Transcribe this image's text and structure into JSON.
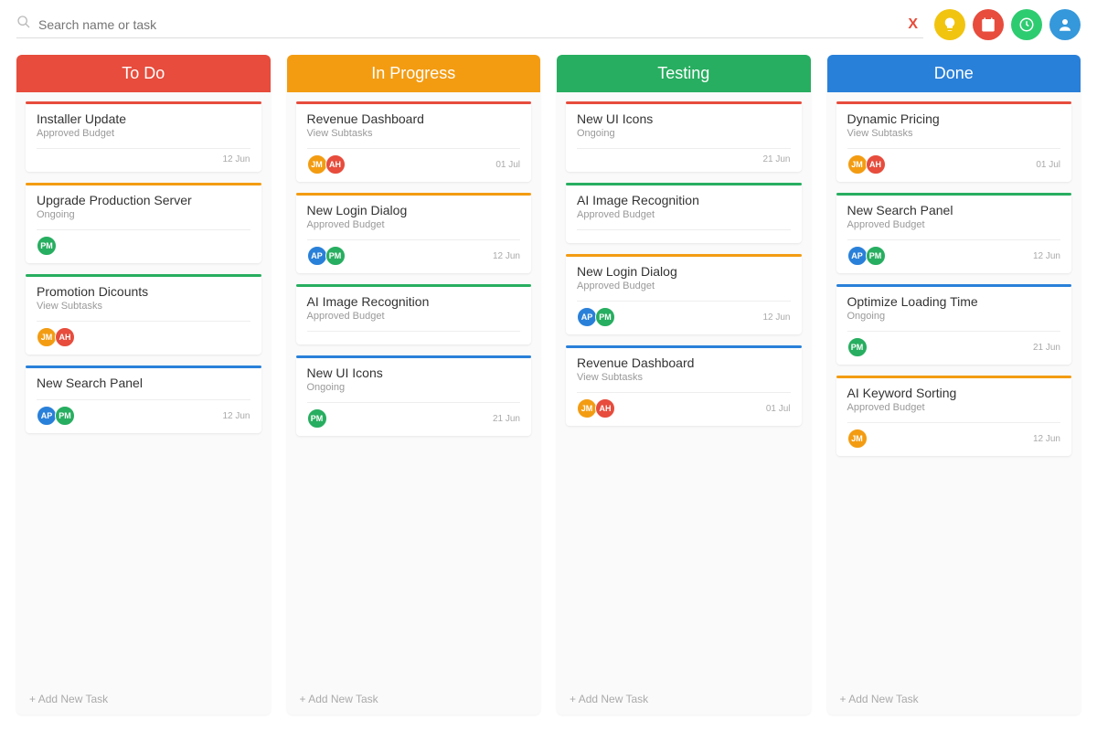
{
  "search": {
    "placeholder": "Search name or task",
    "clear_symbol": "X"
  },
  "top_icons": [
    {
      "name": "lightbulb-icon",
      "color": "#f1c40f"
    },
    {
      "name": "calendar-icon",
      "color": "#e74c3c"
    },
    {
      "name": "clock-icon",
      "color": "#2ecc71"
    },
    {
      "name": "user-icon",
      "color": "#3498db"
    }
  ],
  "add_task_label": "Add New Task",
  "avatar_colors": {
    "JM": "#f39c12",
    "AH": "#e74c3c",
    "PM": "#27ae60",
    "AP": "#2980d9"
  },
  "columns": [
    {
      "id": "todo",
      "title": "To Do",
      "header_color": "#e74c3c",
      "cards": [
        {
          "title": "Installer Update",
          "sub": "Approved Budget",
          "accent": "#e74c3c",
          "date": "12 Jun",
          "avatars": []
        },
        {
          "title": "Upgrade Production Server",
          "sub": "Ongoing",
          "accent": "#f39c12",
          "date": "",
          "avatars": [
            "PM"
          ]
        },
        {
          "title": "Promotion Dicounts",
          "sub": "View Subtasks",
          "accent": "#27ae60",
          "date": "",
          "avatars": [
            "JM",
            "AH"
          ]
        },
        {
          "title": "New Search Panel",
          "sub": "",
          "accent": "#2980d9",
          "date": "12 Jun",
          "avatars": [
            "AP",
            "PM"
          ]
        }
      ]
    },
    {
      "id": "inprogress",
      "title": "In Progress",
      "header_color": "#f39c12",
      "cards": [
        {
          "title": "Revenue Dashboard",
          "sub": "View Subtasks",
          "accent": "#e74c3c",
          "date": "01 Jul",
          "avatars": [
            "JM",
            "AH"
          ]
        },
        {
          "title": "New Login Dialog",
          "sub": "Approved Budget",
          "accent": "#f39c12",
          "date": "12 Jun",
          "avatars": [
            "AP",
            "PM"
          ]
        },
        {
          "title": "AI Image Recognition",
          "sub": "Approved Budget",
          "accent": "#27ae60",
          "date": "",
          "avatars": []
        },
        {
          "title": "New UI Icons",
          "sub": "Ongoing",
          "accent": "#2980d9",
          "date": "21 Jun",
          "avatars": [
            "PM"
          ]
        }
      ]
    },
    {
      "id": "testing",
      "title": "Testing",
      "header_color": "#27ae60",
      "cards": [
        {
          "title": "New UI Icons",
          "sub": "Ongoing",
          "accent": "#e74c3c",
          "date": "21 Jun",
          "avatars": []
        },
        {
          "title": "AI Image Recognition",
          "sub": "Approved Budget",
          "accent": "#27ae60",
          "date": "",
          "avatars": []
        },
        {
          "title": "New Login Dialog",
          "sub": "Approved Budget",
          "accent": "#f39c12",
          "date": "12 Jun",
          "avatars": [
            "AP",
            "PM"
          ]
        },
        {
          "title": "Revenue Dashboard",
          "sub": "View Subtasks",
          "accent": "#2980d9",
          "date": "01 Jul",
          "avatars": [
            "JM",
            "AH"
          ]
        }
      ]
    },
    {
      "id": "done",
      "title": "Done",
      "header_color": "#2980d9",
      "cards": [
        {
          "title": "Dynamic Pricing",
          "sub": "View Subtasks",
          "accent": "#e74c3c",
          "date": "01 Jul",
          "avatars": [
            "JM",
            "AH"
          ]
        },
        {
          "title": "New Search Panel",
          "sub": "Approved Budget",
          "accent": "#27ae60",
          "date": "12 Jun",
          "avatars": [
            "AP",
            "PM"
          ]
        },
        {
          "title": "Optimize Loading Time",
          "sub": "Ongoing",
          "accent": "#2980d9",
          "date": "21 Jun",
          "avatars": [
            "PM"
          ]
        },
        {
          "title": "AI Keyword Sorting",
          "sub": "Approved Budget",
          "accent": "#f39c12",
          "date": "12 Jun",
          "avatars": [
            "JM"
          ]
        }
      ]
    }
  ]
}
